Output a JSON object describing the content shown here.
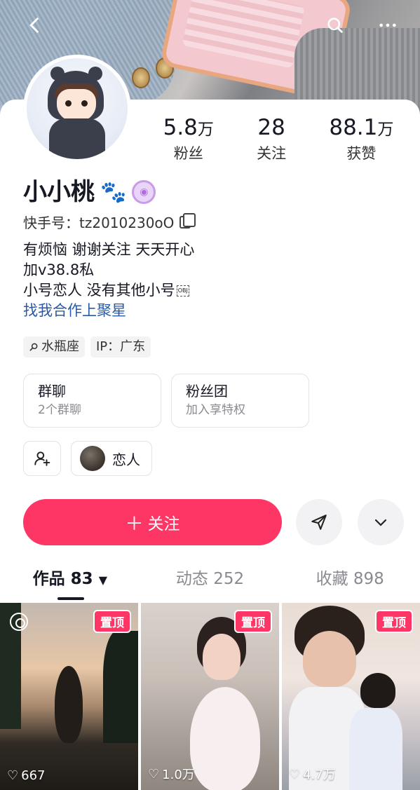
{
  "profile": {
    "name": "小小桃",
    "paw_emoji": "🐾",
    "id_label": "快手号：",
    "id_value": "tz2010230oO"
  },
  "stats": [
    {
      "num": "5.8",
      "unit": "万",
      "label": "粉丝"
    },
    {
      "num": "28",
      "unit": "",
      "label": "关注"
    },
    {
      "num": "88.1",
      "unit": "万",
      "label": "获赞"
    }
  ],
  "bio": {
    "line1": "有烦恼 谢谢关注 天天开心",
    "line2": "加v38.8私",
    "line3": "小号恋人 没有其他小号",
    "line3_suffix": "OBJ",
    "link": "找我合作上聚星"
  },
  "tags": {
    "zodiac": "水瓶座",
    "ip": "IP：广东"
  },
  "groups": [
    {
      "title": "群聊",
      "sub": "2个群聊"
    },
    {
      "title": "粉丝团",
      "sub": "加入享特权"
    }
  ],
  "relation": {
    "label": "恋人"
  },
  "actions": {
    "follow": "关注",
    "follow_prefix": "＋"
  },
  "tabs": [
    {
      "label": "作品 83",
      "active": true
    },
    {
      "label": "动态 252",
      "active": false
    },
    {
      "label": "收藏 898",
      "active": false
    }
  ],
  "works": [
    {
      "pin": "置顶",
      "likes": "667"
    },
    {
      "pin": "置顶",
      "likes": "1.0万"
    },
    {
      "pin": "置顶",
      "likes": "4.7万"
    }
  ],
  "colors": {
    "accent": "#fe3666",
    "link": "#2a5aa7"
  },
  "icons": [
    "back-icon",
    "search-icon",
    "more-icon",
    "copy-icon",
    "search-small-icon",
    "add-friend-icon",
    "share-icon",
    "chevron-down-icon",
    "heart-icon",
    "live-icon"
  ]
}
